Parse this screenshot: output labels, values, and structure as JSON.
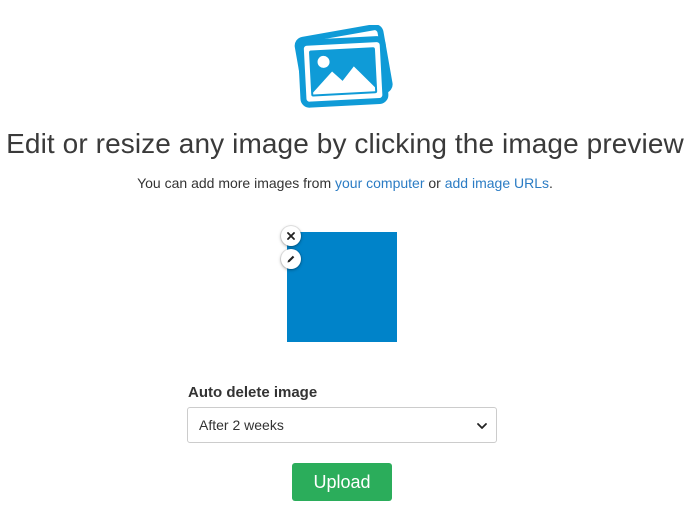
{
  "logo": {
    "icon": "photos-stack-icon",
    "color": "#0f9bd7"
  },
  "headline": "Edit or resize any image by clicking the image preview",
  "subline": {
    "prefix": "You can add more images from ",
    "link_computer": "your computer",
    "middle": " or ",
    "link_urls": "add image URLs",
    "suffix": "."
  },
  "preview": {
    "color": "#0083c9",
    "remove_icon": "close-icon",
    "edit_icon": "pencil-icon"
  },
  "auto_delete": {
    "label": "Auto delete image",
    "selected": "After 2 weeks"
  },
  "upload_label": "Upload",
  "colors": {
    "accent": "#2bad5b",
    "link": "#2b7cc4"
  }
}
